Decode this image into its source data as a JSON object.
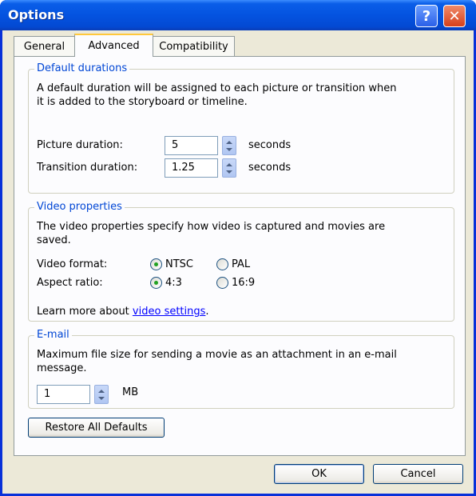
{
  "window": {
    "title": "Options",
    "help_glyph": "?",
    "close_glyph": "✕"
  },
  "tabs": [
    "General",
    "Advanced",
    "Compatibility"
  ],
  "default_durations": {
    "legend": "Default durations",
    "description_line1": "A default duration will be assigned to each picture or transition when",
    "description_line2": "it is added to the storyboard or timeline.",
    "picture_label": "Picture duration:",
    "picture_value": "5",
    "transition_label": "Transition duration:",
    "transition_value": "1.25",
    "unit": "seconds"
  },
  "video_properties": {
    "legend": "Video properties",
    "description_line1": "The video properties specify how video is captured and movies are",
    "description_line2": "saved.",
    "format_label": "Video format:",
    "format_options": [
      "NTSC",
      "PAL"
    ],
    "format_selected": "NTSC",
    "aspect_label": "Aspect ratio:",
    "aspect_options": [
      "4:3",
      "16:9"
    ],
    "aspect_selected": "4:3",
    "learn_prefix": "Learn more about ",
    "learn_link": "video settings",
    "learn_suffix": "."
  },
  "email": {
    "legend": "E-mail",
    "description_line1": "Maximum file size for sending a movie as an attachment in an e-mail",
    "description_line2": "message.",
    "size_value": "1",
    "unit": "MB"
  },
  "buttons": {
    "restore": "Restore All Defaults",
    "ok": "OK",
    "cancel": "Cancel"
  }
}
